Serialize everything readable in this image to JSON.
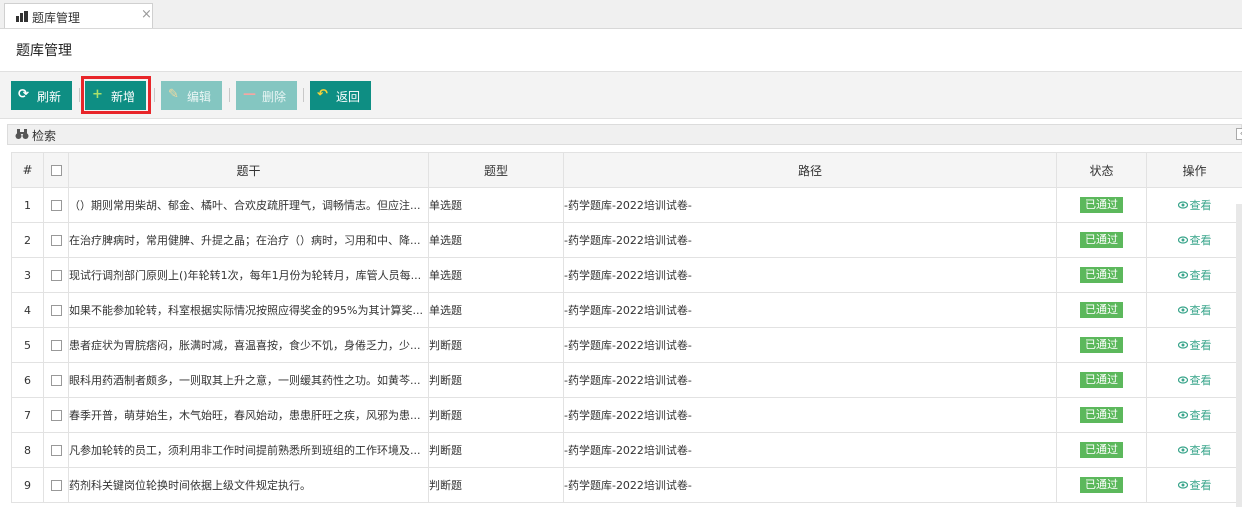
{
  "tab": {
    "label": "题库管理",
    "close": "×"
  },
  "page": {
    "title": "题库管理"
  },
  "toolbar": {
    "refresh": "刷新",
    "add": "新增",
    "edit": "编辑",
    "delete": "删除",
    "back": "返回"
  },
  "search": {
    "title": "检索"
  },
  "table": {
    "headers": {
      "index": "#",
      "stem": "题干",
      "type": "题型",
      "path": "路径",
      "status": "状态",
      "action": "操作"
    },
    "rows": [
      {
        "index": "1",
        "stem": "（）期则常用柴胡、郁金、橘叶、合欢皮疏肝理气，调畅情志。但应注...",
        "type": "单选题",
        "path": "-药学题库-2022培训试卷-",
        "status": "已通过",
        "action": "查看"
      },
      {
        "index": "2",
        "stem": "在治疗脾病时，常用健脾、升提之晶；在治疗（）病时，习用和中、降...",
        "type": "单选题",
        "path": "-药学题库-2022培训试卷-",
        "status": "已通过",
        "action": "查看"
      },
      {
        "index": "3",
        "stem": "现试行调剂部门原则上()年轮转1次，每年1月份为轮转月，库管人员每...",
        "type": "单选题",
        "path": "-药学题库-2022培训试卷-",
        "status": "已通过",
        "action": "查看"
      },
      {
        "index": "4",
        "stem": "如果不能参加轮转，科室根据实际情况按照应得奖金的95%为其计算奖...",
        "type": "单选题",
        "path": "-药学题库-2022培训试卷-",
        "status": "已通过",
        "action": "查看"
      },
      {
        "index": "5",
        "stem": "患者症状为胃脘痞闷，胀满时减，喜温喜按，食少不饥，身倦乏力，少...",
        "type": "判断题",
        "path": "-药学题库-2022培训试卷-",
        "status": "已通过",
        "action": "查看"
      },
      {
        "index": "6",
        "stem": "眼科用药酒制者颇多，一则取其上升之意，一则缓其药性之功。如黄芩...",
        "type": "判断题",
        "path": "-药学题库-2022培训试卷-",
        "status": "已通过",
        "action": "查看"
      },
      {
        "index": "7",
        "stem": "春季开普，萌芽始生，木气始旺，春风始动，患患肝旺之疾，风邪为患...",
        "type": "判断题",
        "path": "-药学题库-2022培训试卷-",
        "status": "已通过",
        "action": "查看"
      },
      {
        "index": "8",
        "stem": "凡参加轮转的员工，须利用非工作时间提前熟悉所到班组的工作环境及...",
        "type": "判断题",
        "path": "-药学题库-2022培训试卷-",
        "status": "已通过",
        "action": "查看"
      },
      {
        "index": "9",
        "stem": "药剂科关键岗位轮换时间依据上级文件规定执行。",
        "type": "判断题",
        "path": "-药学题库-2022培训试卷-",
        "status": "已通过",
        "action": "查看"
      }
    ]
  },
  "colors": {
    "primary": "#0e8e83",
    "disabled": "#84c6c1",
    "highlight": "#e8262a",
    "status_ok": "#5cb85c",
    "link": "#3aa58b"
  }
}
